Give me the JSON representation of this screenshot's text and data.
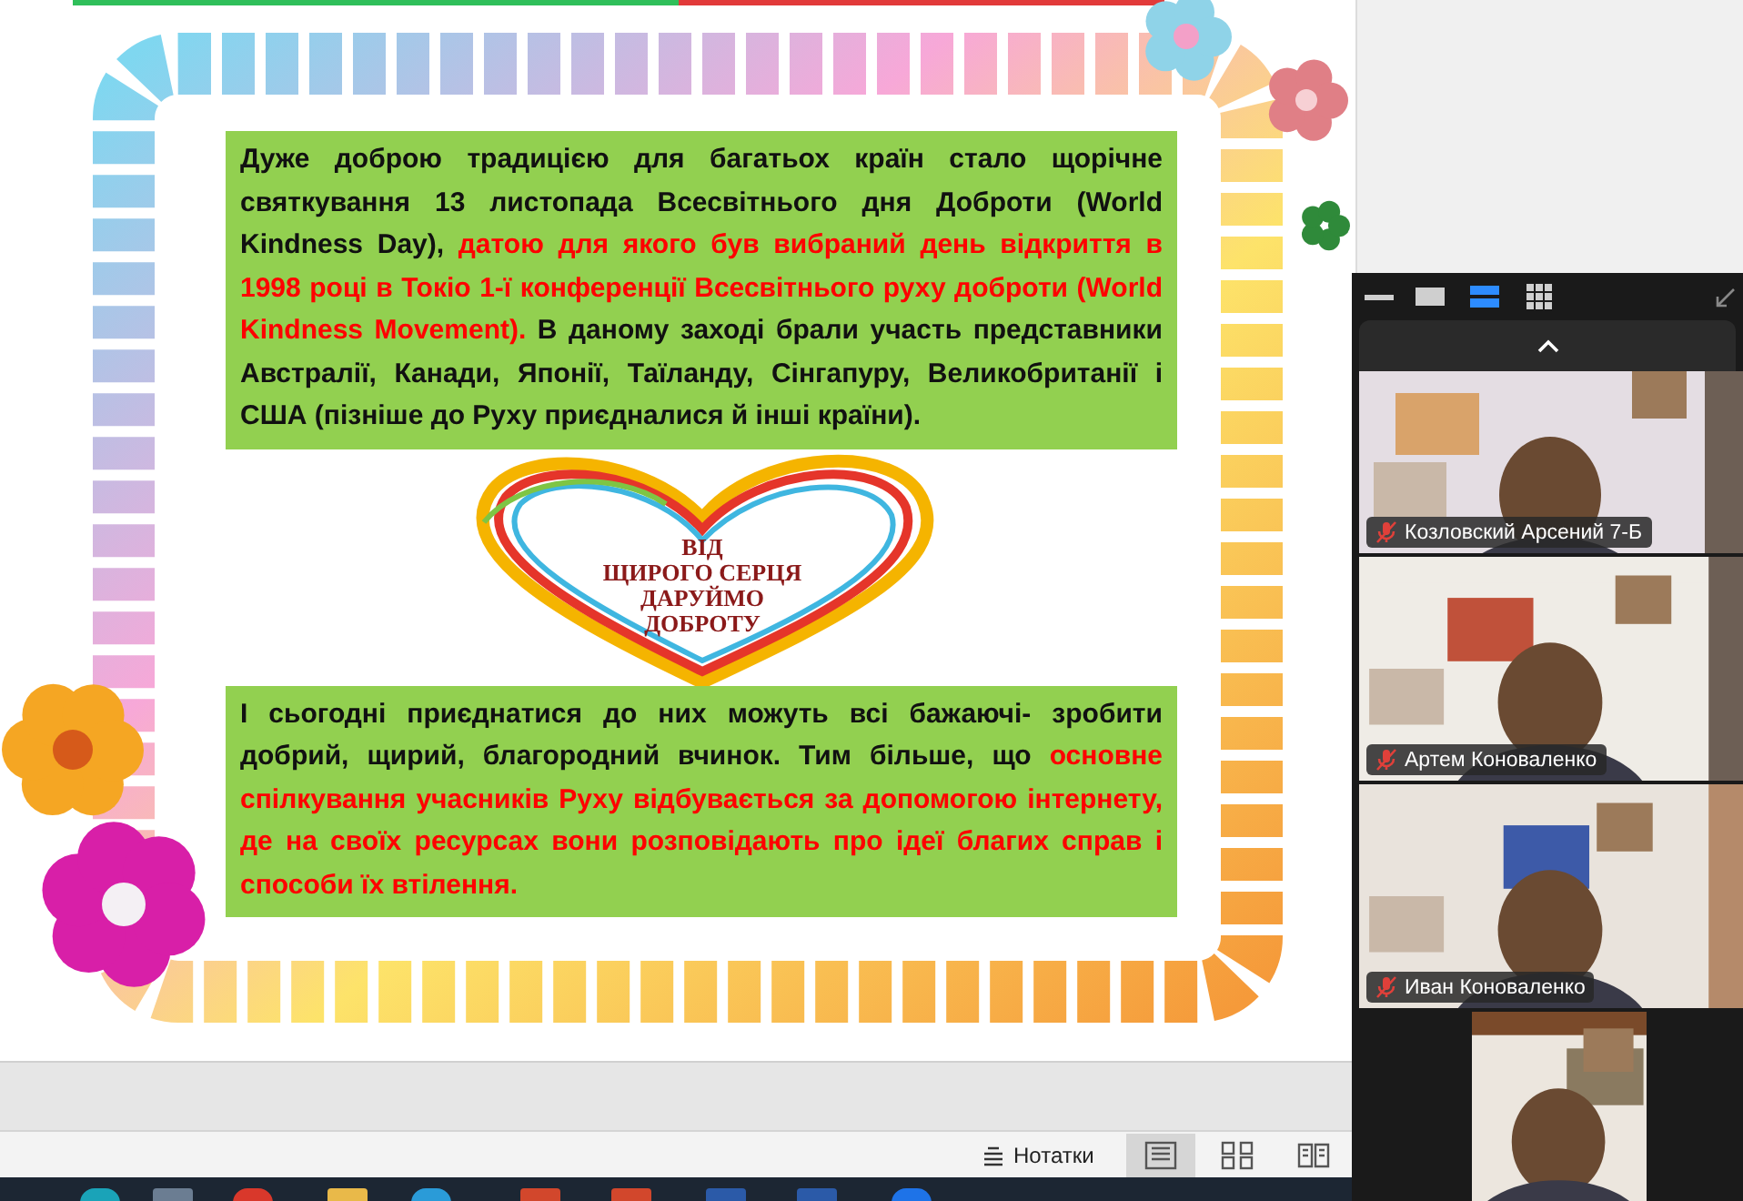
{
  "slide": {
    "paragraphs": [
      {
        "segments": [
          {
            "text": "Дуже доброю традицією для багатьох країн стало щорічне святкування 13 листопада Всесвітнього дня Доброти (World Kindness Day), ",
            "emphasis": false
          },
          {
            "text": "датою для якого був вибраний день відкриття в 1998 році в Токіо 1-ї конференції Всесвітнього руху доброти (World Kindness Movement).",
            "emphasis": true
          },
          {
            "text": " В даному заході брали участь представники Австралії, Канади, Японії, Таїланду, Сінгапуру, Великобританії і США (пізніше до Руху приєдналися й інші країни).",
            "emphasis": false
          }
        ]
      },
      {
        "segments": [
          {
            "text": "І сьогодні приєднатися до них можуть всі бажаючі- зробити добрий, щирий, благородний вчинок. Тим більше, що ",
            "emphasis": false
          },
          {
            "text": "основне спілкування учасників Руху відбувається за допомогою інтернету, де на своїх ресурсах вони розповідають про ідеї благих справ і способи їх втілення.",
            "emphasis": true
          }
        ]
      }
    ],
    "heart_caption": [
      "ВІД",
      "ЩИРОГО СЕРЦЯ",
      "ДАРУЙМО",
      "ДОБРОТУ"
    ]
  },
  "video_panel": {
    "view_modes": [
      {
        "kind": "minimize",
        "selected": false
      },
      {
        "kind": "speaker",
        "selected": false
      },
      {
        "kind": "strip",
        "selected": true
      },
      {
        "kind": "grid",
        "selected": false
      }
    ],
    "tiles": [
      {
        "kind": "participant",
        "name": "Козловский Арсений 7-Б",
        "muted": true
      },
      {
        "kind": "participant",
        "name": "Артем Коноваленко",
        "muted": true
      },
      {
        "kind": "participant",
        "name": "Иван Коноваленко",
        "muted": true
      },
      {
        "kind": "picture"
      }
    ]
  },
  "status_bar": {
    "notes_label": "Нотатки",
    "views": [
      {
        "kind": "normal",
        "selected": true
      },
      {
        "kind": "sorter",
        "selected": false
      },
      {
        "kind": "reading",
        "selected": false
      }
    ]
  }
}
